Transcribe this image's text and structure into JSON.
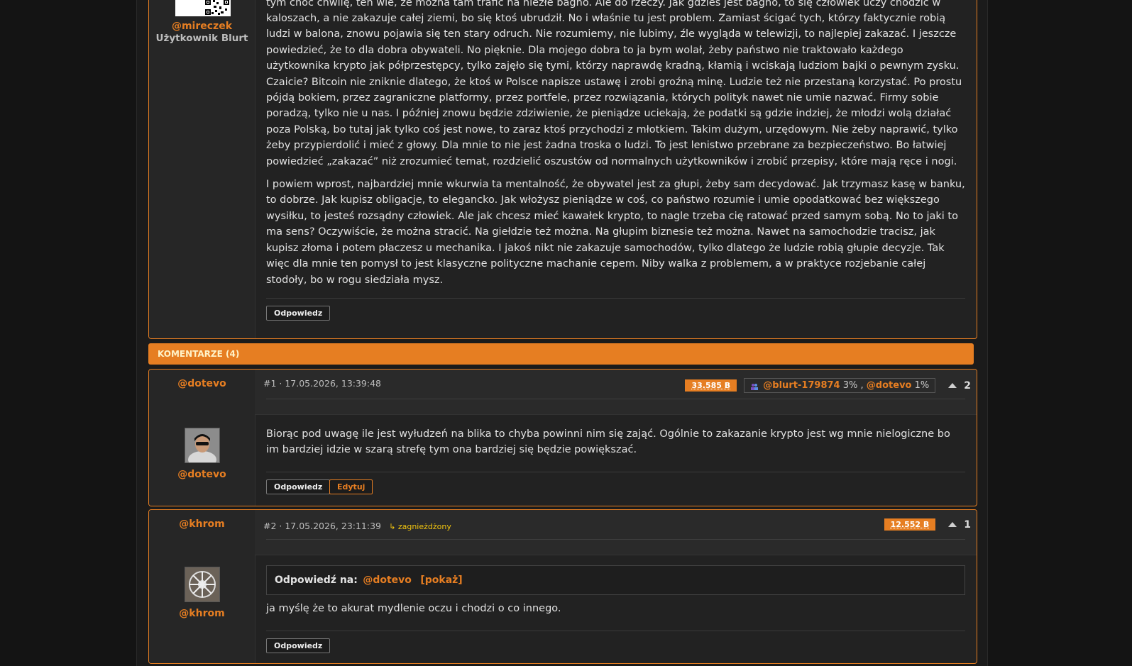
{
  "post": {
    "author": "@mireczek",
    "role": "Użytkownik Blurt",
    "para1_partial": "tym choć chwilę, ten wie, że można tam trafić na niezłe bagno. Ale do rzeczy. Jak gdzieś jest bagno, to się człowiek uczy chodzić w",
    "para1": "kaloszach, a nie zakazuje całej ziemi, bo się ktoś ubrudził. No i właśnie tu jest problem. Zamiast ścigać tych, którzy faktycznie robią ludzi w balona, znowu pojawia się ten stary odruch. Nie rozumiemy, nie lubimy, źle wygląda w telewizji, to najlepiej zakazać. I jeszcze powiedzieć, że to dla dobra obywateli. No pięknie. Dla mojego dobra to ja bym wolał, żeby państwo nie traktowało każdego użytkownika krypto jak półprzestępcy, tylko zajęło się tymi, którzy naprawdę kradną, kłamią i wciskają ludziom bajki o pewnym zysku. Czaicie? Bitcoin nie zniknie dlatego, że ktoś w Polsce napisze ustawę i zrobi groźną minę. Ludzie też nie przestaną korzystać. Po prostu pójdą bokiem, przez zagraniczne platformy, przez portfele, przez rozwiązania, których polityk nawet nie umie nazwać. Firmy sobie poradzą, tylko nie u nas. I później znowu będzie zdziwienie, że pieniądze uciekają, że podatki są gdzie indziej, że młodzi wolą działać poza Polską, bo tutaj jak tylko coś jest nowe, to zaraz ktoś przychodzi z młotkiem. Takim dużym, urzędowym. Nie żeby naprawić, tylko żeby przypierdolić i mieć z głowy. Dla mnie to nie jest żadna troska o ludzi. To jest lenistwo przebrane za bezpieczeństwo. Bo łatwiej powiedzieć „zakazać” niż zrozumieć temat, rozdzielić oszustów od normalnych użytkowników i zrobić przepisy, które mają ręce i nogi.",
    "para2": "I powiem wprost, najbardziej mnie wkurwia ta mentalność, że obywatel jest za głupi, żeby sam decydować. Jak trzymasz kasę w banku, to dobrze. Jak kupisz obligacje, to elegancko. Jak włożysz pieniądze w coś, co państwo rozumie i umie opodatkować bez większego wysiłku, to jesteś rozsądny człowiek. Ale jak chcesz mieć kawałek krypto, to nagle trzeba cię ratować przed samym sobą. No to jaki to ma sens? Oczywiście, że można stracić. Na giełdzie też można. Na głupim biznesie też można. Nawet na samochodzie tracisz, jak kupisz złoma i potem płaczesz u mechanika. I jakoś nikt nie zakazuje samochodów, tylko dlatego że ludzie robią głupie decyzje. Tak więc dla mnie ten pomysł to jest klasyczne polityczne machanie cepem. Niby walka z problemem, a w praktyce rozjebanie całej stodoły, bo w rogu siedziała mysz.",
    "reply_label": "Odpowiedz"
  },
  "comments_header": "KOMENTARZE (4)",
  "comments": [
    {
      "author": "@dotevo",
      "meta": "#1 · 17.05.2026, 13:39:48",
      "value": "33.585 B",
      "voter1": "@blurt-179874",
      "voter1_pct": "3%",
      "sep": ",",
      "voter2": "@dotevo",
      "voter2_pct": "1%",
      "votes": "2",
      "text": "Biorąc pod uwagę ile jest wyłudzeń na blika to chyba powinni nim się zająć. Ogólnie to zakazanie krypto jest wg mnie nielogiczne bo im bardziej idzie w szarą strefę tym ona bardziej się będzie powiększać.",
      "reply_label": "Odpowiedz",
      "edit_label": "Edytuj"
    },
    {
      "author": "@khrom",
      "meta": "#2 · 17.05.2026, 23:11:39",
      "nested": "↳ zagnieżdżony",
      "value": "12.552 B",
      "votes": "1",
      "quote_label": "Odpowiedź na:",
      "quote_user": "@dotevo",
      "quote_show": "[pokaż]",
      "text": "ja myślę że to akurat mydlenie oczu i chodzi o co innego.",
      "reply_label": "Odpowiedz"
    }
  ]
}
